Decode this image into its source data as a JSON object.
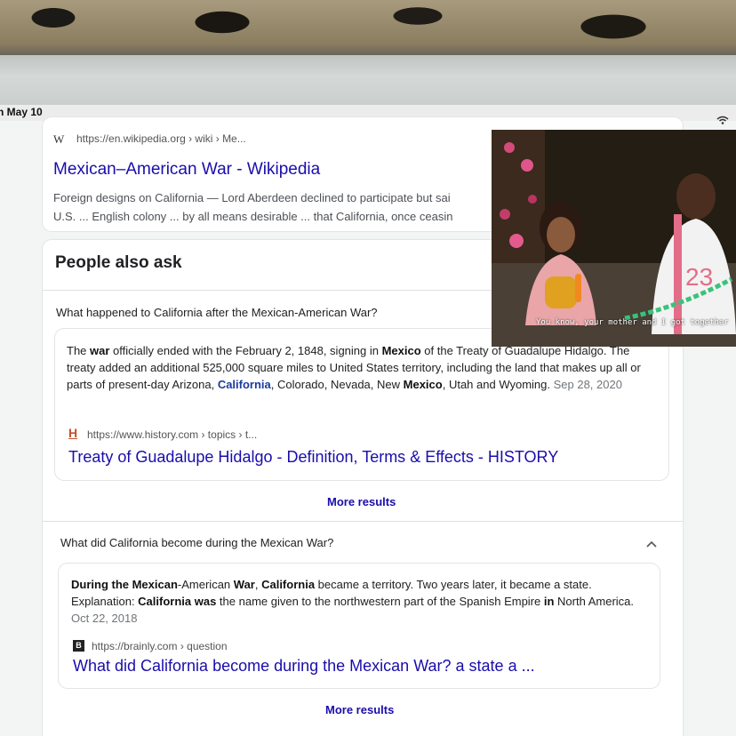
{
  "status": {
    "date": "n May 10"
  },
  "wiki": {
    "favicon": "W",
    "url": "https://en.wikipedia.org › wiki › Me...",
    "title": "Mexican–American War - Wikipedia",
    "snippet_line1": "Foreign designs on California — Lord Aberdeen declined to participate but sai",
    "snippet_line2": "U.S. ... English colony ... by all means desirable ... that California, once ceasin"
  },
  "paa": {
    "heading": "People also ask",
    "q1": {
      "question": "What happened to California after the Mexican-American War?",
      "date": "Sep 28, 2020",
      "favicon": "H",
      "source_url": "https://www.history.com › topics › t...",
      "link_title": "Treaty of Guadalupe Hidalgo - Definition, Terms & Effects - HISTORY",
      "more": "More results"
    },
    "q2": {
      "question": "What did California become during the Mexican War?",
      "date": "Oct 22, 2018",
      "favicon": "B",
      "source_url": "https://brainly.com › question",
      "link_title": "What did California become during the Mexican War? a state a ...",
      "more": "More results"
    }
  },
  "video": {
    "caption": "You know, your mother and I got together",
    "jersey_number": "23"
  },
  "colors": {
    "link": "#1a0dab",
    "text": "#202124",
    "muted": "#70757a"
  }
}
